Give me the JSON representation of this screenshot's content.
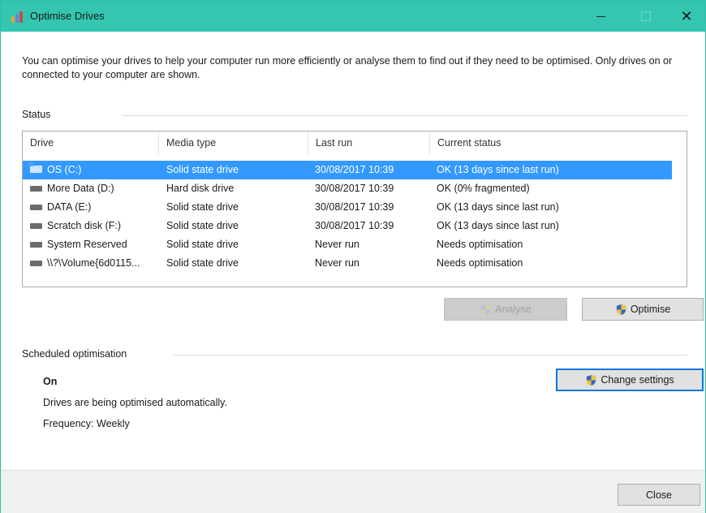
{
  "window": {
    "title": "Optimise Drives"
  },
  "intro_text": "You can optimise your drives to help your computer run more efficiently or analyse them to find out if they need to be optimised. Only drives on or connected to your computer are shown.",
  "status_label": "Status",
  "columns": [
    "Drive",
    "Media type",
    "Last run",
    "Current status"
  ],
  "drives": [
    {
      "drive": "OS (C:)",
      "media": "Solid state drive",
      "last_run": "30/08/2017 10:39",
      "status": "OK (13 days since last run)",
      "icon": "os-drive-icon",
      "selected": true
    },
    {
      "drive": "More Data (D:)",
      "media": "Hard disk drive",
      "last_run": "30/08/2017 10:39",
      "status": "OK (0% fragmented)",
      "icon": "drive-icon",
      "selected": false
    },
    {
      "drive": "DATA (E:)",
      "media": "Solid state drive",
      "last_run": "30/08/2017 10:39",
      "status": "OK (13 days since last run)",
      "icon": "drive-icon",
      "selected": false
    },
    {
      "drive": "Scratch disk (F:)",
      "media": "Solid state drive",
      "last_run": "30/08/2017 10:39",
      "status": "OK (13 days since last run)",
      "icon": "drive-icon",
      "selected": false
    },
    {
      "drive": "System Reserved",
      "media": "Solid state drive",
      "last_run": "Never run",
      "status": "Needs optimisation",
      "icon": "drive-icon",
      "selected": false
    },
    {
      "drive": "\\\\?\\Volume{6d0115...",
      "media": "Solid state drive",
      "last_run": "Never run",
      "status": "Needs optimisation",
      "icon": "drive-icon",
      "selected": false
    }
  ],
  "buttons": {
    "analyse": "Analyse",
    "optimise": "Optimise",
    "change_settings": "Change settings",
    "close": "Close"
  },
  "scheduled": {
    "label": "Scheduled optimisation",
    "state": "On",
    "description": "Drives are being optimised automatically.",
    "frequency": "Frequency: Weekly"
  },
  "colors": {
    "titlebar": "#34c6b0",
    "selection": "#3399ff",
    "focus_border": "#0078d7"
  }
}
